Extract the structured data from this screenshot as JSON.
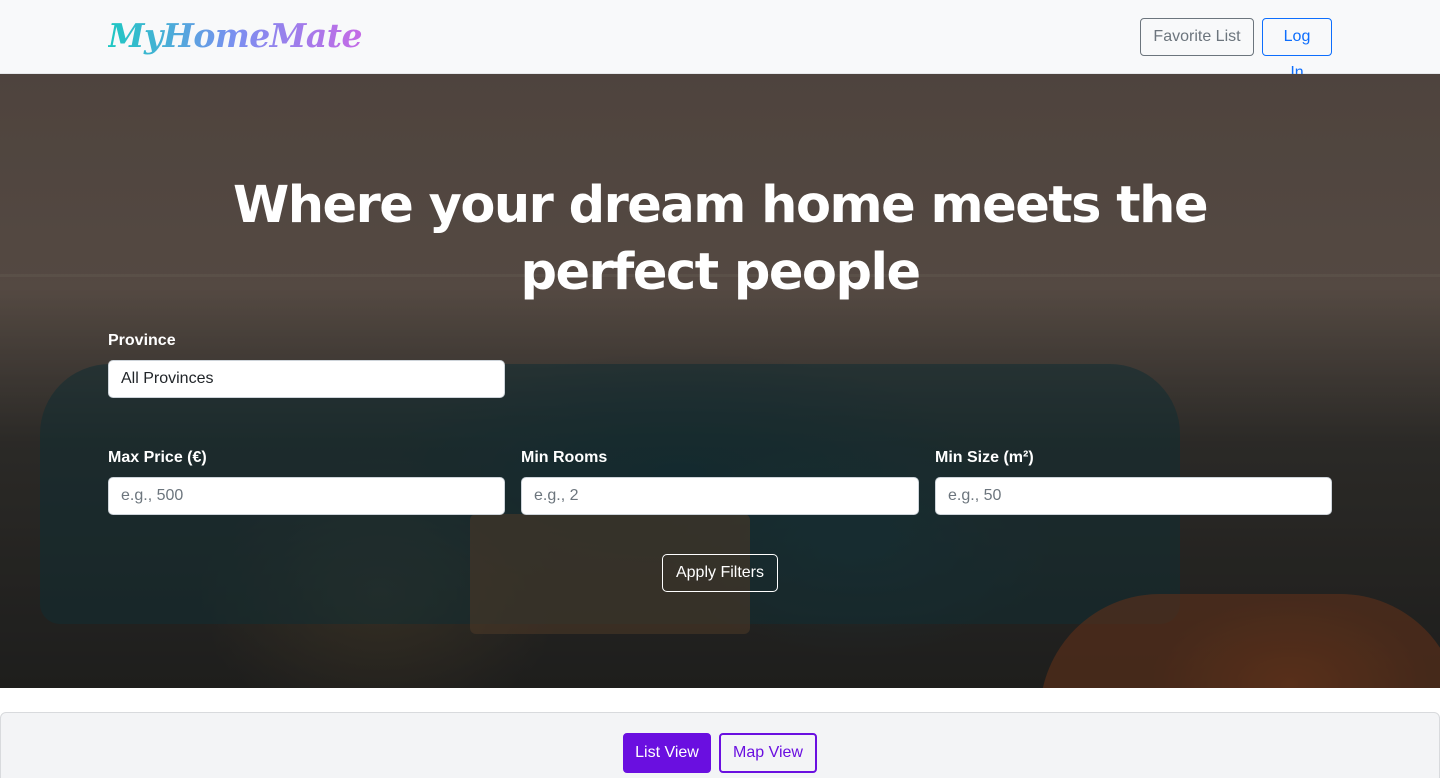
{
  "navbar": {
    "logo": "MyHomeMate",
    "favorite_label": "Favorite List",
    "login_label": "Log In"
  },
  "hero": {
    "title": "Where your dream home meets the perfect people"
  },
  "filters": {
    "province_label": "Province",
    "province_value": "All Provinces",
    "max_price_label": "Max Price (€)",
    "max_price_placeholder": "e.g., 500",
    "min_rooms_label": "Min Rooms",
    "min_rooms_placeholder": "e.g., 2",
    "min_size_label": "Min Size (m²)",
    "min_size_placeholder": "e.g., 50",
    "apply_label": "Apply Filters"
  },
  "views": {
    "list_label": "List View",
    "map_label": "Map View"
  },
  "colors": {
    "accent": "#6a0fe0",
    "login": "#0d6efd"
  }
}
